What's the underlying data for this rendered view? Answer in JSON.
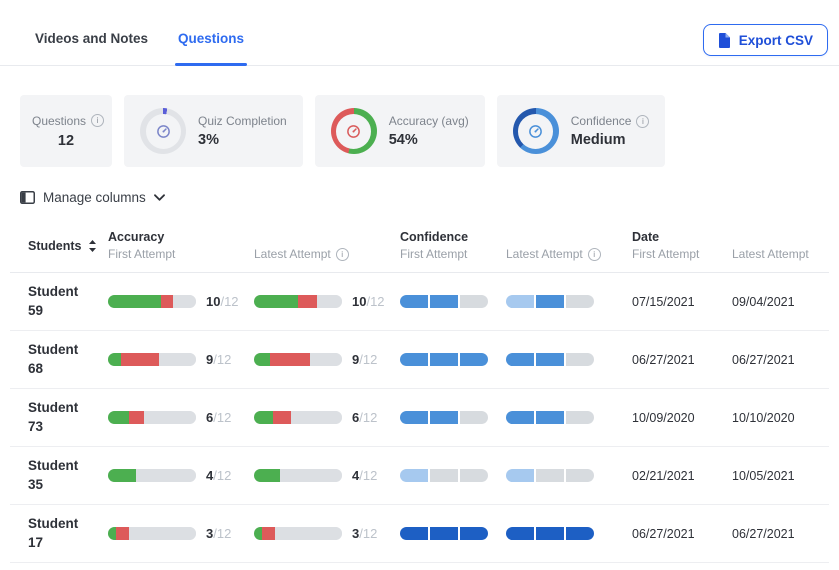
{
  "colors": {
    "accent_blue": "#2e6bf0",
    "green": "#4caf50",
    "red": "#dd5a5a",
    "bar_gray": "#dcdfe3",
    "confidence_light": "#a6c9ef",
    "confidence_medium": "#4a90d9",
    "confidence_dark": "#1d5fc4"
  },
  "tabs": [
    {
      "label": "Videos and Notes"
    },
    {
      "label": "Questions"
    }
  ],
  "export_button": {
    "label": "Export CSV"
  },
  "stats": {
    "questions": {
      "label": "Questions",
      "value": "12"
    },
    "quiz_completion": {
      "label": "Quiz Completion",
      "value": "3%",
      "donut": [
        {
          "color": "#5a5ed8",
          "pct": 3
        },
        {
          "color": "#e1e3e7",
          "pct": 97
        }
      ]
    },
    "accuracy": {
      "label": "Accuracy (avg)",
      "value": "54%",
      "donut": [
        {
          "color": "#4caf50",
          "pct": 54
        },
        {
          "color": "#dd5a5a",
          "pct": 46
        }
      ]
    },
    "confidence": {
      "label": "Confidence",
      "value": "Medium",
      "donut": [
        {
          "color": "#4a90d9",
          "pct": 62
        },
        {
          "color": "#2458ad",
          "pct": 38
        }
      ]
    }
  },
  "manage_columns_label": "Manage columns",
  "table": {
    "header": {
      "students": "Students",
      "accuracy_group": "Accuracy",
      "confidence_group": "Confidence",
      "date_group": "Date",
      "first_attempt": "First Attempt",
      "latest_attempt": "Latest Attempt"
    },
    "rows": [
      {
        "name_line1": "Student",
        "name_line2": "59",
        "acc_first": {
          "score": "10",
          "total": "/12",
          "segments": [
            {
              "color": "#4caf50",
              "pct": 60
            },
            {
              "color": "#dd5a5a",
              "pct": 14
            },
            {
              "color": "#dcdfe3",
              "pct": 26
            }
          ]
        },
        "acc_latest": {
          "score": "10",
          "total": "/12",
          "segments": [
            {
              "color": "#4caf50",
              "pct": 50
            },
            {
              "color": "#dd5a5a",
              "pct": 22
            },
            {
              "color": "#dcdfe3",
              "pct": 28
            }
          ]
        },
        "conf_first": [
          "#4a90d9",
          "#4a90d9",
          "#d7dbdf"
        ],
        "conf_latest": [
          "#a6c9ef",
          "#4a90d9",
          "#d7dbdf"
        ],
        "date_first": "07/15/2021",
        "date_latest": "09/04/2021"
      },
      {
        "name_line1": "Student",
        "name_line2": "68",
        "acc_first": {
          "score": "9",
          "total": "/12",
          "segments": [
            {
              "color": "#4caf50",
              "pct": 15
            },
            {
              "color": "#dd5a5a",
              "pct": 43
            },
            {
              "color": "#dcdfe3",
              "pct": 42
            }
          ]
        },
        "acc_latest": {
          "score": "9",
          "total": "/12",
          "segments": [
            {
              "color": "#4caf50",
              "pct": 18
            },
            {
              "color": "#dd5a5a",
              "pct": 46
            },
            {
              "color": "#dcdfe3",
              "pct": 36
            }
          ]
        },
        "conf_first": [
          "#4a90d9",
          "#4a90d9",
          "#4a90d9"
        ],
        "conf_latest": [
          "#4a90d9",
          "#4a90d9",
          "#d7dbdf"
        ],
        "date_first": "06/27/2021",
        "date_latest": "06/27/2021"
      },
      {
        "name_line1": "Student",
        "name_line2": "73",
        "acc_first": {
          "score": "6",
          "total": "/12",
          "segments": [
            {
              "color": "#4caf50",
              "pct": 24
            },
            {
              "color": "#dd5a5a",
              "pct": 17
            },
            {
              "color": "#dcdfe3",
              "pct": 59
            }
          ]
        },
        "acc_latest": {
          "score": "6",
          "total": "/12",
          "segments": [
            {
              "color": "#4caf50",
              "pct": 22
            },
            {
              "color": "#dd5a5a",
              "pct": 20
            },
            {
              "color": "#dcdfe3",
              "pct": 58
            }
          ]
        },
        "conf_first": [
          "#4a90d9",
          "#4a90d9",
          "#d7dbdf"
        ],
        "conf_latest": [
          "#4a90d9",
          "#4a90d9",
          "#d7dbdf"
        ],
        "date_first": "10/09/2020",
        "date_latest": "10/10/2020"
      },
      {
        "name_line1": "Student",
        "name_line2": "35",
        "acc_first": {
          "score": "4",
          "total": "/12",
          "segments": [
            {
              "color": "#4caf50",
              "pct": 32
            },
            {
              "color": "#dcdfe3",
              "pct": 68
            }
          ]
        },
        "acc_latest": {
          "score": "4",
          "total": "/12",
          "segments": [
            {
              "color": "#4caf50",
              "pct": 30
            },
            {
              "color": "#dcdfe3",
              "pct": 70
            }
          ]
        },
        "conf_first": [
          "#a6c9ef",
          "#d7dbdf",
          "#d7dbdf"
        ],
        "conf_latest": [
          "#a6c9ef",
          "#d7dbdf",
          "#d7dbdf"
        ],
        "date_first": "02/21/2021",
        "date_latest": "10/05/2021"
      },
      {
        "name_line1": "Student",
        "name_line2": "17",
        "acc_first": {
          "score": "3",
          "total": "/12",
          "segments": [
            {
              "color": "#4caf50",
              "pct": 9
            },
            {
              "color": "#dd5a5a",
              "pct": 15
            },
            {
              "color": "#dcdfe3",
              "pct": 76
            }
          ]
        },
        "acc_latest": {
          "score": "3",
          "total": "/12",
          "segments": [
            {
              "color": "#4caf50",
              "pct": 9
            },
            {
              "color": "#dd5a5a",
              "pct": 15
            },
            {
              "color": "#dcdfe3",
              "pct": 76
            }
          ]
        },
        "conf_first": [
          "#1d5fc4",
          "#1d5fc4",
          "#1d5fc4"
        ],
        "conf_latest": [
          "#1d5fc4",
          "#1d5fc4",
          "#1d5fc4"
        ],
        "date_first": "06/27/2021",
        "date_latest": "06/27/2021"
      }
    ]
  }
}
